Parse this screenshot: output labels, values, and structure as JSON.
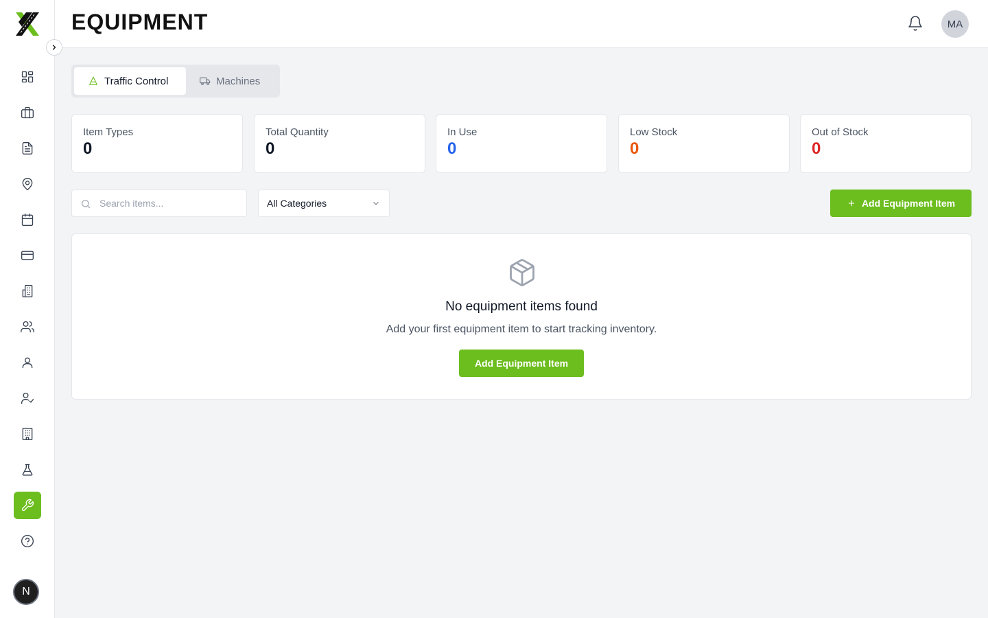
{
  "header": {
    "title": "EQUIPMENT",
    "avatar_initials": "MA"
  },
  "sidebar": {
    "items": [
      {
        "icon": "dashboard-icon"
      },
      {
        "icon": "briefcase-icon"
      },
      {
        "icon": "document-icon"
      },
      {
        "icon": "location-pin-icon"
      },
      {
        "icon": "calendar-icon"
      },
      {
        "icon": "credit-card-icon"
      },
      {
        "icon": "buildings-icon"
      },
      {
        "icon": "users-icon"
      },
      {
        "icon": "user-icon"
      },
      {
        "icon": "user-check-icon"
      },
      {
        "icon": "office-building-icon"
      },
      {
        "icon": "flask-icon"
      },
      {
        "icon": "wrench-icon",
        "active": true
      },
      {
        "icon": "help-circle-icon"
      }
    ],
    "footer_badge": "N"
  },
  "tabs": [
    {
      "label": "Traffic Control",
      "icon": "cone-icon",
      "active": true
    },
    {
      "label": "Machines",
      "icon": "truck-icon",
      "active": false
    }
  ],
  "stats": [
    {
      "label": "Item Types",
      "value": "0",
      "color": "#111827"
    },
    {
      "label": "Total Quantity",
      "value": "0",
      "color": "#111827"
    },
    {
      "label": "In Use",
      "value": "0",
      "color": "#2563eb"
    },
    {
      "label": "Low Stock",
      "value": "0",
      "color": "#ea580c"
    },
    {
      "label": "Out of Stock",
      "value": "0",
      "color": "#dc2626"
    }
  ],
  "toolbar": {
    "search_placeholder": "Search items...",
    "category_selected": "All Categories",
    "add_label": "Add Equipment Item"
  },
  "empty_state": {
    "title": "No equipment items found",
    "subtitle": "Add your first equipment item to start tracking inventory.",
    "button_label": "Add Equipment Item"
  },
  "colors": {
    "accent": "#6cbd1e"
  }
}
